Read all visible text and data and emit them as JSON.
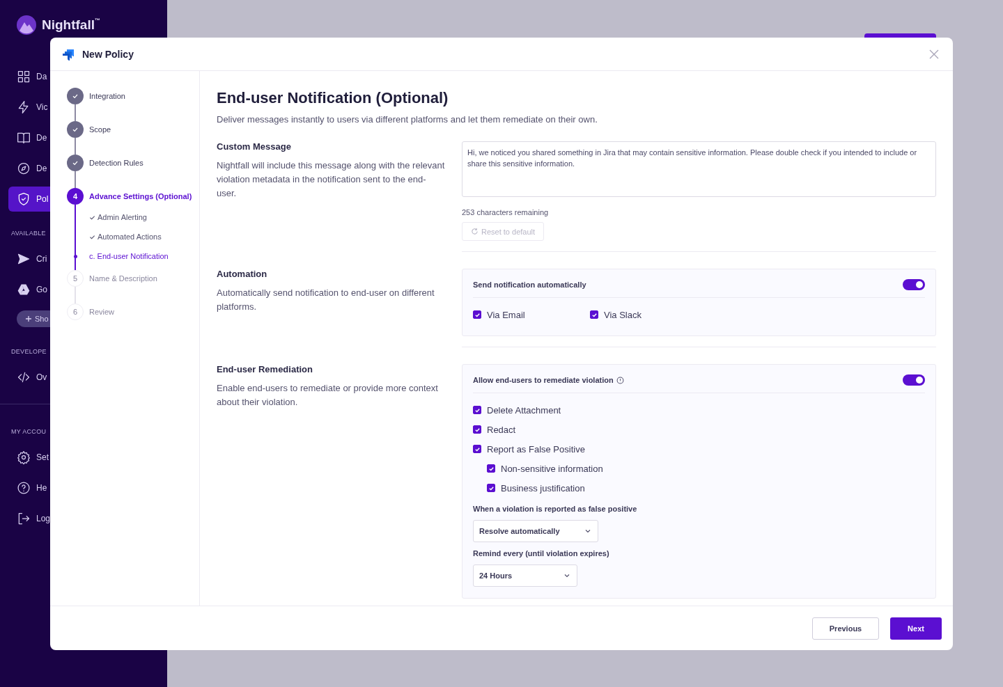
{
  "sidebar": {
    "brand": "Nightfall",
    "trademark": "™",
    "sections": [
      {
        "items": [
          {
            "label": "Da",
            "selected": false
          },
          {
            "label": "Vic",
            "selected": false
          },
          {
            "label": "De",
            "selected": false
          },
          {
            "label": "De",
            "selected": false
          },
          {
            "label": "Pol",
            "selected": true
          }
        ]
      },
      {
        "heading": "AVAILABLE",
        "items": [
          {
            "label": "Cri",
            "selected": false
          },
          {
            "label": "Go",
            "selected": false
          }
        ],
        "button": "Sho"
      },
      {
        "heading": "DEVELOPE",
        "items": [
          {
            "label": "Ov",
            "selected": false
          }
        ]
      },
      {
        "heading": "MY ACCOU",
        "items": [
          {
            "label": "Set",
            "selected": false
          },
          {
            "label": "He",
            "selected": false
          },
          {
            "label": "Log",
            "selected": false
          }
        ]
      }
    ]
  },
  "modal": {
    "title": "New Policy",
    "steps": [
      {
        "label": "Integration",
        "completed": true,
        "current": false
      },
      {
        "label": "Scope",
        "completed": true,
        "current": false
      },
      {
        "label": "Detection Rules",
        "completed": true,
        "current": false
      },
      {
        "number": "4",
        "label": "Advance Settings (Optional)",
        "completed": false,
        "current": true,
        "children": [
          {
            "label": "Admin Alerting",
            "completed": true,
            "current": false
          },
          {
            "label": "Automated Actions",
            "completed": true,
            "current": false
          },
          {
            "label": "c. End-user Notification",
            "completed": false,
            "current": true
          }
        ]
      },
      {
        "number": "5",
        "label": "Name & Description",
        "completed": false,
        "current": false
      },
      {
        "number": "6",
        "label": "Review",
        "completed": false,
        "current": false
      }
    ],
    "heading": "End-user Notification (Optional)",
    "description": "Deliver messages instantly to users via different platforms and let them remediate on their own.",
    "custom_message": {
      "title": "Custom Message",
      "description": "Nightfall will include this message along with the relevant violation metadata in the notification sent to the end-user.",
      "value": "Hi, we noticed you shared something in Jira that may contain sensitive information. Please double check if you intended to include or share this sensitive information.",
      "counter": "253 characters remaining",
      "reset_button": {
        "label": "Reset to default",
        "disabled": true
      }
    },
    "automation": {
      "title": "Automation",
      "description": "Automatically send notification to end-user on different platforms.",
      "toggle_label": "Send notification automatically",
      "on": true,
      "options": [
        {
          "label": "Via Email",
          "checked": true
        },
        {
          "label": "Via Slack",
          "checked": true
        }
      ]
    },
    "remediation": {
      "title": "End-user Remediation",
      "description": "Enable end-users to remediate or provide more context about their violation.",
      "toggle_label": "Allow end-users to remediate violation",
      "on": true,
      "options": [
        {
          "label": "Delete Attachment",
          "checked": true
        },
        {
          "label": "Redact",
          "checked": true
        },
        {
          "label": "Report as False Positive",
          "checked": true,
          "children": [
            {
              "label": "Non-sensitive information",
              "checked": true
            },
            {
              "label": "Business justification",
              "checked": true
            }
          ]
        }
      ],
      "selects": [
        {
          "label": "When a violation is reported as false positive",
          "value": "Resolve automatically"
        },
        {
          "label": "Remind every (until violation expires)",
          "value": "24 Hours"
        }
      ]
    },
    "footer": {
      "previous": "Previous",
      "next": "Next"
    }
  }
}
